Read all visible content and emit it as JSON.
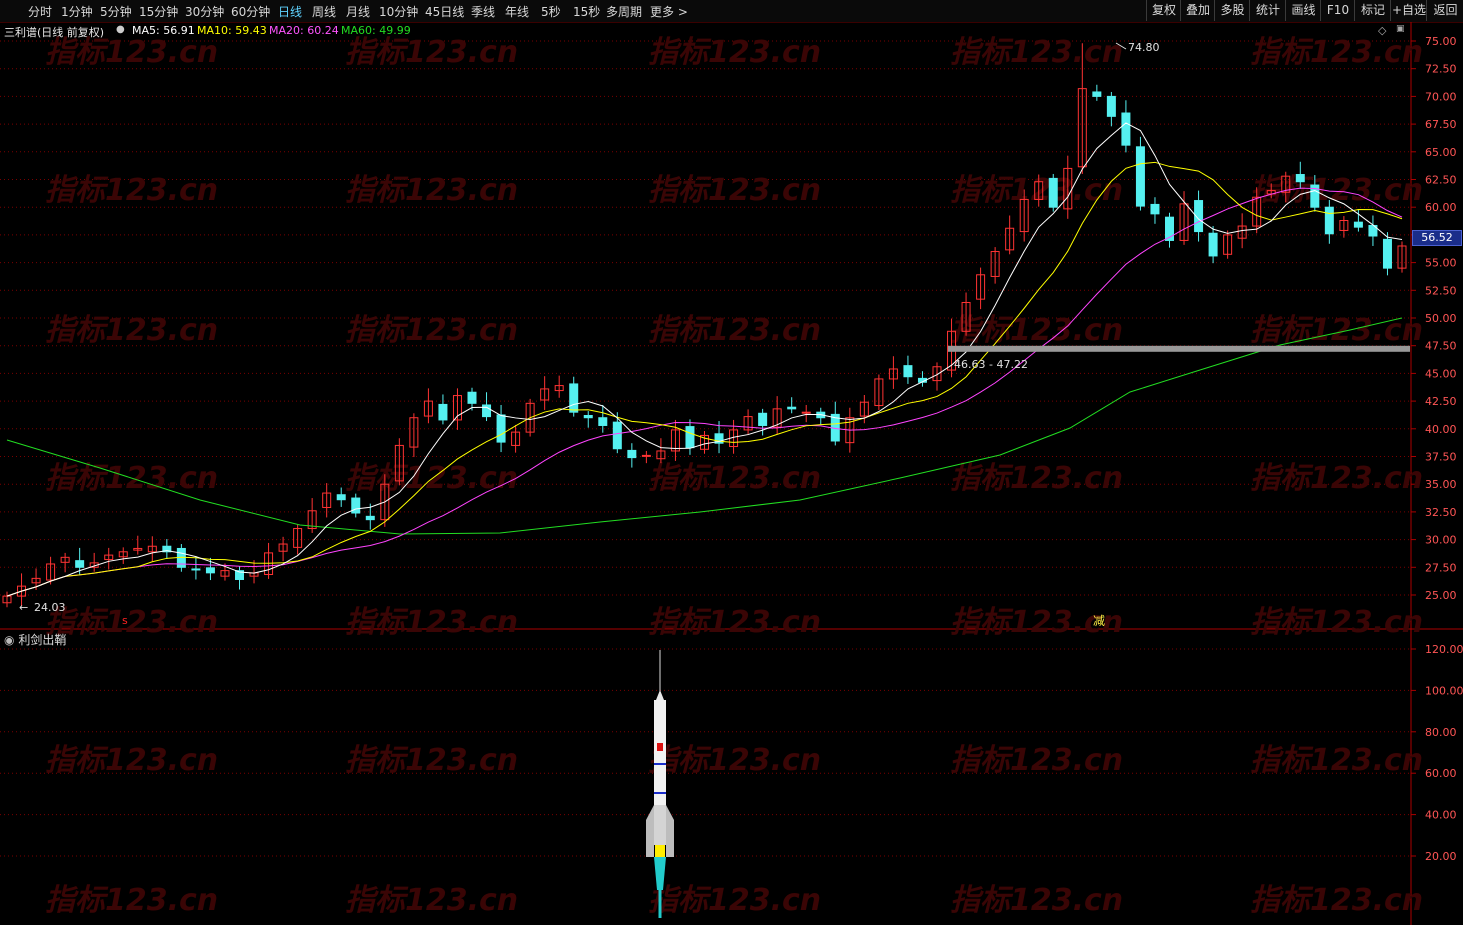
{
  "toolbar": {
    "periods": [
      "分时",
      "1分钟",
      "5分钟",
      "15分钟",
      "30分钟",
      "60分钟",
      "日线",
      "周线",
      "月线",
      "10分钟",
      "45日线",
      "季线",
      "年线",
      "5秒",
      "15秒",
      "多周期",
      "更多 >"
    ],
    "active_period": "日线",
    "right_buttons": [
      "复权",
      "叠加",
      "多股",
      "统计",
      "画线",
      "F10",
      "标记",
      "+自选",
      "返回"
    ]
  },
  "info": {
    "stock": "三利谱(日线 前复权)",
    "ma5": "MA5: 56.91",
    "ma10": "MA10: 59.43",
    "ma20": "MA20: 60.24",
    "ma60": "MA60: 49.99",
    "colors": {
      "ma5": "#ffffff",
      "ma10": "#ffff00",
      "ma20": "#ff44ff",
      "ma60": "#22dd22"
    }
  },
  "main_chart": {
    "y_ticks": [
      "75.00",
      "72.50",
      "70.00",
      "67.50",
      "65.00",
      "62.50",
      "60.00",
      "57.50",
      "55.00",
      "52.50",
      "50.00",
      "47.50",
      "45.00",
      "42.50",
      "40.00",
      "37.50",
      "35.00",
      "32.50",
      "30.00",
      "27.50",
      "25.00"
    ],
    "current_price": "56.52",
    "high_label": "74.80",
    "low_label": "24.03",
    "zone_label": "46.63 - 47.22",
    "signal_s": "s",
    "signal_reduce": "减",
    "watermark": "指标123.cn",
    "colors": {
      "up": "#ff3333",
      "down": "#55f0f0",
      "zone": "#999999",
      "grid": "#7a0000"
    }
  },
  "indicator": {
    "title": "利剑出鞘",
    "y_ticks": [
      "120.00",
      "100.00",
      "80.00",
      "60.00",
      "40.00",
      "20.00"
    ]
  }
}
